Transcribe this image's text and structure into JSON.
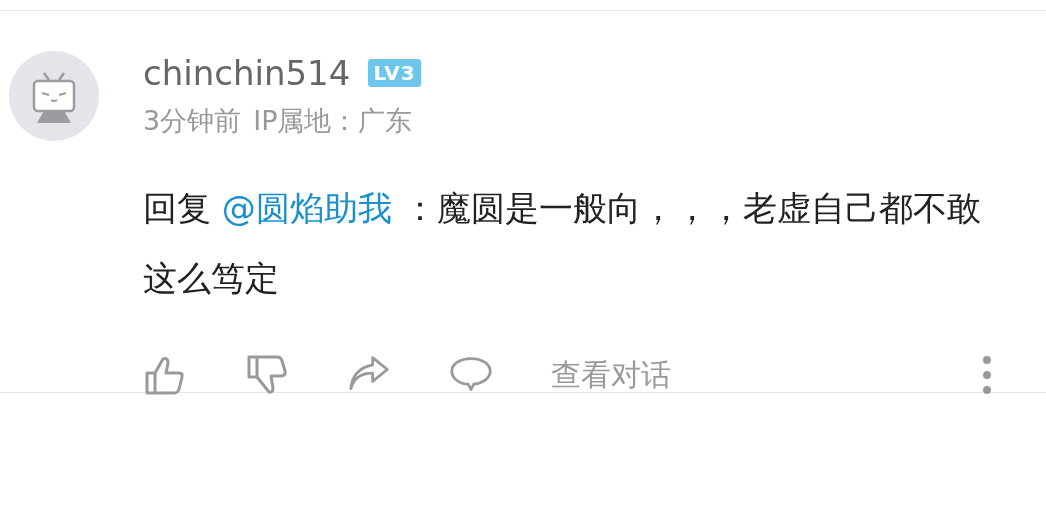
{
  "comment": {
    "username": "chinchin514",
    "level_badge": "LV3",
    "time": "3分钟前",
    "ip_location": "IP属地：广东",
    "reply_prefix": "回复",
    "mention": "@圆焰助我",
    "text": "：魔圆是一般向，，，老虚自己都不敢这么笃定",
    "view_conversation": "查看对话"
  }
}
